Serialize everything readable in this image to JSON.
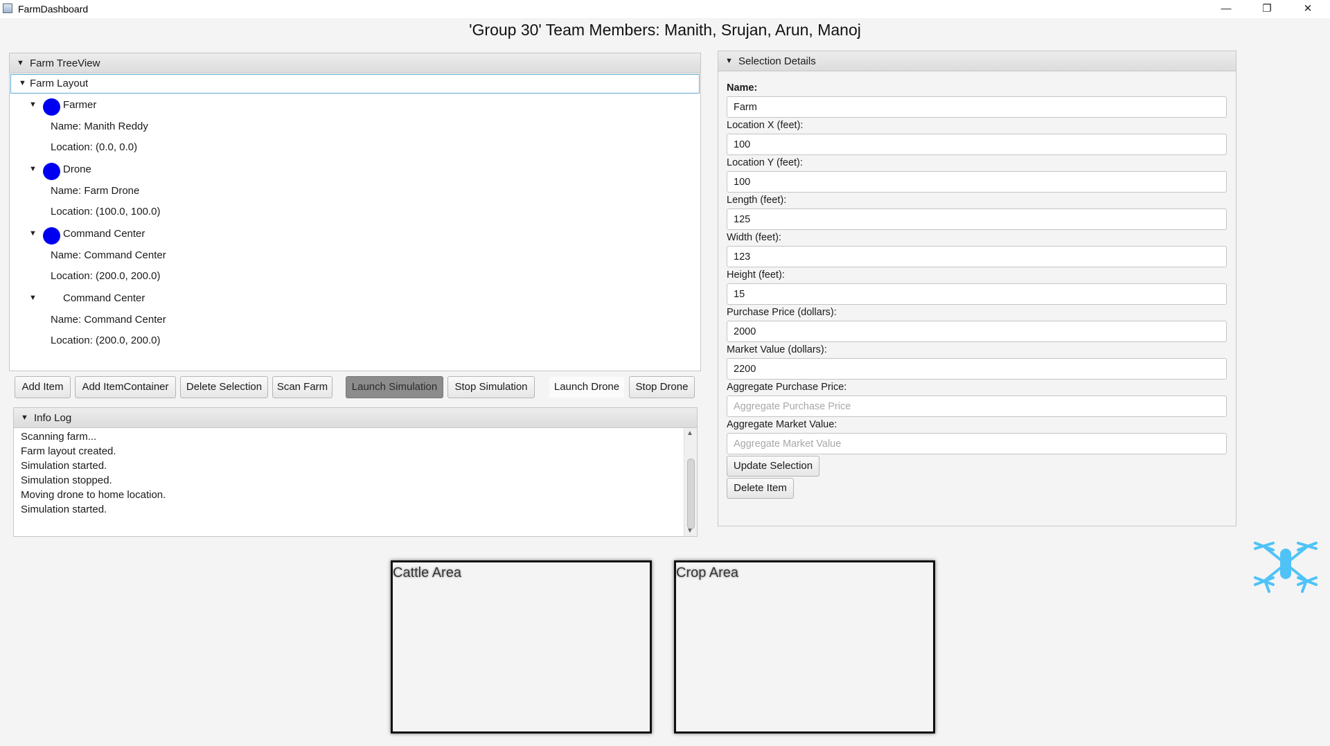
{
  "window": {
    "title": "FarmDashboard",
    "minimize_glyph": "—",
    "maximize_glyph": "❐",
    "close_glyph": "✕"
  },
  "page_title": "'Group 30' Team Members: Manith, Srujan, Arun, Manoj",
  "tree_panel": {
    "title": "Farm TreeView",
    "root": "Farm Layout",
    "items": [
      {
        "label": "Farmer",
        "has_dot": true,
        "children": [
          "Name: Manith Reddy",
          "Location: (0.0, 0.0)"
        ]
      },
      {
        "label": "Drone",
        "has_dot": true,
        "children": [
          "Name: Farm Drone",
          "Location: (100.0, 100.0)"
        ]
      },
      {
        "label": "Command Center",
        "has_dot": true,
        "children": [
          "Name: Command Center",
          "Location: (200.0, 200.0)"
        ]
      },
      {
        "label": "Command Center",
        "has_dot": false,
        "children": [
          "Name: Command Center",
          "Location: (200.0, 200.0)"
        ]
      }
    ],
    "dot_color": "#0000f0"
  },
  "toolbar": {
    "add_item": "Add Item",
    "add_item_container": "Add ItemContainer",
    "delete_selection": "Delete Selection",
    "scan_farm": "Scan Farm",
    "launch_simulation": "Launch Simulation",
    "stop_simulation": "Stop Simulation",
    "launch_drone": "Launch Drone",
    "stop_drone": "Stop Drone"
  },
  "info_log": {
    "title": "Info Log",
    "lines": [
      "Scanning farm...",
      "Farm layout created.",
      "Simulation started.",
      "Simulation stopped.",
      "Moving drone to home location.",
      "Simulation started."
    ]
  },
  "details": {
    "title": "Selection Details",
    "fields": [
      {
        "label": "Name:",
        "value": "Farm",
        "placeholder": ""
      },
      {
        "label": "Location X (feet):",
        "value": "100",
        "placeholder": ""
      },
      {
        "label": "Location Y (feet):",
        "value": "100",
        "placeholder": ""
      },
      {
        "label": "Length (feet):",
        "value": "125",
        "placeholder": ""
      },
      {
        "label": "Width (feet):",
        "value": "123",
        "placeholder": ""
      },
      {
        "label": "Height (feet):",
        "value": "15",
        "placeholder": ""
      },
      {
        "label": "Purchase Price (dollars):",
        "value": "2000",
        "placeholder": ""
      },
      {
        "label": "Market Value (dollars):",
        "value": "2200",
        "placeholder": ""
      },
      {
        "label": "Aggregate Purchase Price:",
        "value": "",
        "placeholder": "Aggregate Purchase Price"
      },
      {
        "label": "Aggregate Market Value:",
        "value": "",
        "placeholder": "Aggregate Market Value"
      }
    ],
    "update_button": "Update Selection",
    "delete_button": "Delete Item"
  },
  "canvas": {
    "areas": [
      "Cattle Area",
      "Crop Area"
    ],
    "drone_icon": "drone-icon",
    "drone_color": "#4fc3f7"
  }
}
